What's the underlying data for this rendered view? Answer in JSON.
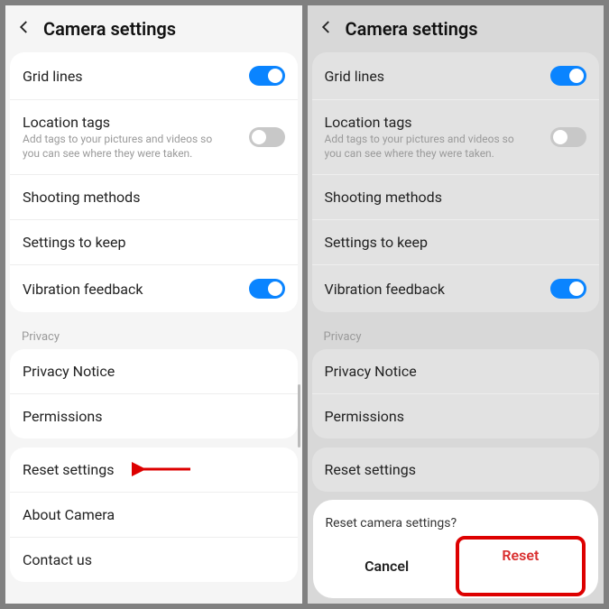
{
  "left": {
    "title": "Camera settings",
    "settings": {
      "grid_lines": {
        "label": "Grid lines",
        "on": true
      },
      "location_tags": {
        "label": "Location tags",
        "sub": "Add tags to your pictures and videos so you can see where they were taken.",
        "on": false
      },
      "shooting_methods": {
        "label": "Shooting methods"
      },
      "settings_to_keep": {
        "label": "Settings to keep"
      },
      "vibration_feedback": {
        "label": "Vibration feedback",
        "on": true
      }
    },
    "privacy_header": "Privacy",
    "privacy": {
      "privacy_notice": {
        "label": "Privacy Notice"
      },
      "permissions": {
        "label": "Permissions"
      }
    },
    "more": {
      "reset_settings": {
        "label": "Reset settings"
      },
      "about_camera": {
        "label": "About Camera"
      },
      "contact_us": {
        "label": "Contact us"
      }
    }
  },
  "right": {
    "title": "Camera settings",
    "settings": {
      "grid_lines": {
        "label": "Grid lines",
        "on": true
      },
      "location_tags": {
        "label": "Location tags",
        "sub": "Add tags to your pictures and videos so you can see where they were taken.",
        "on": false
      },
      "shooting_methods": {
        "label": "Shooting methods"
      },
      "settings_to_keep": {
        "label": "Settings to keep"
      },
      "vibration_feedback": {
        "label": "Vibration feedback",
        "on": true
      }
    },
    "privacy_header": "Privacy",
    "privacy": {
      "privacy_notice": {
        "label": "Privacy Notice"
      },
      "permissions": {
        "label": "Permissions"
      }
    },
    "more": {
      "reset_settings": {
        "label": "Reset settings"
      }
    },
    "dialog": {
      "title": "Reset camera settings?",
      "cancel": "Cancel",
      "reset": "Reset"
    }
  }
}
